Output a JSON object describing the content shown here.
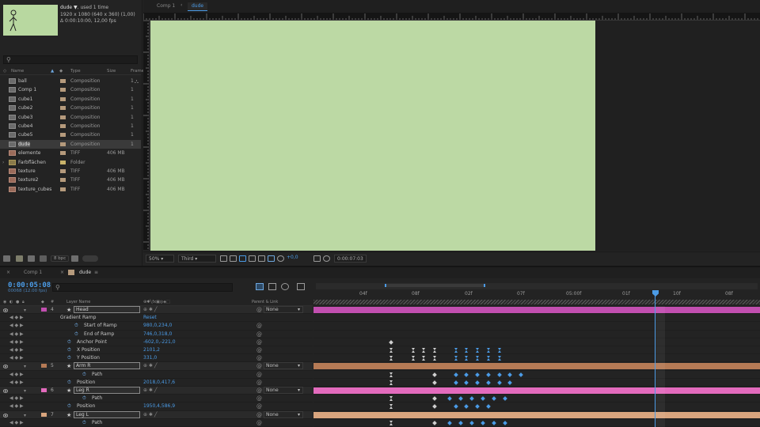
{
  "project": {
    "item_name": "dude ▼",
    "used": ", used 1 time",
    "info_line1": "1920 x 1080  (640 x 360) (1,00)",
    "info_line2": "Δ 0:00:10:00, 12,00 fps",
    "search_icon": "search-icon",
    "columns": [
      "Name",
      "Type",
      "Size",
      "Frame"
    ],
    "items": [
      {
        "name": "ball",
        "type": "Composition",
        "size": "",
        "frame": "1"
      },
      {
        "name": "Comp 1",
        "type": "Composition",
        "size": "",
        "frame": "1"
      },
      {
        "name": "cube1",
        "type": "Composition",
        "size": "",
        "frame": "1"
      },
      {
        "name": "cube2",
        "type": "Composition",
        "size": "",
        "frame": "1"
      },
      {
        "name": "cube3",
        "type": "Composition",
        "size": "",
        "frame": "1"
      },
      {
        "name": "cube4",
        "type": "Composition",
        "size": "",
        "frame": "1"
      },
      {
        "name": "cube5",
        "type": "Composition",
        "size": "",
        "frame": "1"
      },
      {
        "name": "dude",
        "type": "Composition",
        "size": "",
        "frame": "1"
      },
      {
        "name": "elemente",
        "type": "TIFF",
        "size": "406 MB",
        "frame": ""
      },
      {
        "name": "Farbflächen",
        "type": "Folder",
        "size": "",
        "frame": ""
      },
      {
        "name": "texture",
        "type": "TIFF",
        "size": "406 MB",
        "frame": ""
      },
      {
        "name": "texture2",
        "type": "TIFF",
        "size": "406 MB",
        "frame": ""
      },
      {
        "name": "texture_cubes",
        "type": "TIFF",
        "size": "406 MB",
        "frame": ""
      }
    ],
    "bpc": "8 bpc"
  },
  "viewer": {
    "tabs": [
      "Comp 1",
      "dude"
    ],
    "zoom": "50%",
    "resolution": "Third",
    "exposure": "+0,0",
    "timecode": "0:00:07:03"
  },
  "timeline": {
    "tabs": [
      "Comp 1",
      "dude"
    ],
    "current_time": "0:00:05:08",
    "frame_info": "00068 (12.00 fps)",
    "search_icon": "search-icon",
    "col_layer_name": "Layer Name",
    "col_parent": "Parent & Link",
    "ruler_labels": [
      "04f",
      "08f",
      "02f",
      "07f",
      "05:00f",
      "01f",
      "10f",
      "08f"
    ],
    "rows": [
      {
        "kind": "layer",
        "num": "4",
        "name": "Head",
        "parent": "None",
        "color": "#c24fb0"
      },
      {
        "kind": "prop",
        "name": "Gradient Ramp",
        "value": "Reset",
        "indent": 76
      },
      {
        "kind": "prop",
        "name": "Start of Ramp",
        "value": "980,0,234,0",
        "indent": 106,
        "sw": true
      },
      {
        "kind": "prop",
        "name": "End of Ramp",
        "value": "746,0,318,0",
        "indent": 106,
        "sw": true
      },
      {
        "kind": "prop",
        "name": "Anchor Point",
        "value": "-602,0,-221,0",
        "indent": 97,
        "sw": true
      },
      {
        "kind": "prop",
        "name": "X Position",
        "value": "2101,2",
        "indent": 97,
        "sw": true
      },
      {
        "kind": "prop",
        "name": "Y Position",
        "value": "331,0",
        "indent": 97,
        "sw": true
      },
      {
        "kind": "layer",
        "num": "5",
        "name": "Arm R",
        "parent": "None",
        "color": "#b57a55"
      },
      {
        "kind": "prop",
        "name": "Path",
        "value": "",
        "indent": 116,
        "sw": true
      },
      {
        "kind": "prop",
        "name": "Position",
        "value": "2018,0,417,6",
        "indent": 97,
        "sw": true
      },
      {
        "kind": "layer",
        "num": "6",
        "name": "Leg R",
        "parent": "None",
        "color": "#e36bbd"
      },
      {
        "kind": "prop",
        "name": "Path",
        "value": "",
        "indent": 116,
        "sw": true
      },
      {
        "kind": "prop",
        "name": "Position",
        "value": "1950,4,586,9",
        "indent": 97,
        "sw": true
      },
      {
        "kind": "layer",
        "num": "7",
        "name": "Leg L",
        "parent": "None",
        "color": "#d9a57e"
      },
      {
        "kind": "prop",
        "name": "Path",
        "value": "",
        "indent": 116,
        "sw": true
      }
    ]
  },
  "colors": {
    "accent": "#4b9be6",
    "comp_bg": "#bcd9a4"
  }
}
